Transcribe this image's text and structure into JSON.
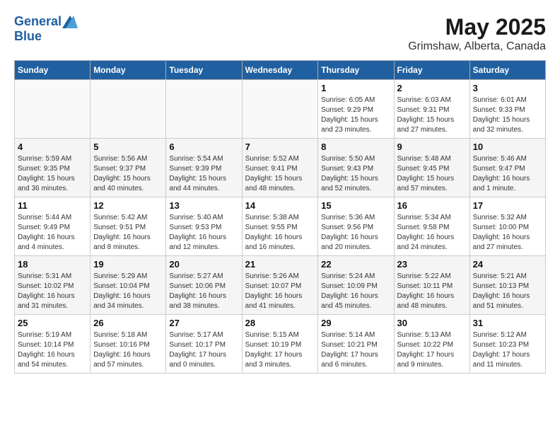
{
  "header": {
    "logo_line1": "General",
    "logo_line2": "Blue",
    "month_title": "May 2025",
    "location": "Grimshaw, Alberta, Canada"
  },
  "weekdays": [
    "Sunday",
    "Monday",
    "Tuesday",
    "Wednesday",
    "Thursday",
    "Friday",
    "Saturday"
  ],
  "weeks": [
    [
      {
        "day": "",
        "info": ""
      },
      {
        "day": "",
        "info": ""
      },
      {
        "day": "",
        "info": ""
      },
      {
        "day": "",
        "info": ""
      },
      {
        "day": "1",
        "info": "Sunrise: 6:05 AM\nSunset: 9:29 PM\nDaylight: 15 hours\nand 23 minutes."
      },
      {
        "day": "2",
        "info": "Sunrise: 6:03 AM\nSunset: 9:31 PM\nDaylight: 15 hours\nand 27 minutes."
      },
      {
        "day": "3",
        "info": "Sunrise: 6:01 AM\nSunset: 9:33 PM\nDaylight: 15 hours\nand 32 minutes."
      }
    ],
    [
      {
        "day": "4",
        "info": "Sunrise: 5:59 AM\nSunset: 9:35 PM\nDaylight: 15 hours\nand 36 minutes."
      },
      {
        "day": "5",
        "info": "Sunrise: 5:56 AM\nSunset: 9:37 PM\nDaylight: 15 hours\nand 40 minutes."
      },
      {
        "day": "6",
        "info": "Sunrise: 5:54 AM\nSunset: 9:39 PM\nDaylight: 15 hours\nand 44 minutes."
      },
      {
        "day": "7",
        "info": "Sunrise: 5:52 AM\nSunset: 9:41 PM\nDaylight: 15 hours\nand 48 minutes."
      },
      {
        "day": "8",
        "info": "Sunrise: 5:50 AM\nSunset: 9:43 PM\nDaylight: 15 hours\nand 52 minutes."
      },
      {
        "day": "9",
        "info": "Sunrise: 5:48 AM\nSunset: 9:45 PM\nDaylight: 15 hours\nand 57 minutes."
      },
      {
        "day": "10",
        "info": "Sunrise: 5:46 AM\nSunset: 9:47 PM\nDaylight: 16 hours\nand 1 minute."
      }
    ],
    [
      {
        "day": "11",
        "info": "Sunrise: 5:44 AM\nSunset: 9:49 PM\nDaylight: 16 hours\nand 4 minutes."
      },
      {
        "day": "12",
        "info": "Sunrise: 5:42 AM\nSunset: 9:51 PM\nDaylight: 16 hours\nand 8 minutes."
      },
      {
        "day": "13",
        "info": "Sunrise: 5:40 AM\nSunset: 9:53 PM\nDaylight: 16 hours\nand 12 minutes."
      },
      {
        "day": "14",
        "info": "Sunrise: 5:38 AM\nSunset: 9:55 PM\nDaylight: 16 hours\nand 16 minutes."
      },
      {
        "day": "15",
        "info": "Sunrise: 5:36 AM\nSunset: 9:56 PM\nDaylight: 16 hours\nand 20 minutes."
      },
      {
        "day": "16",
        "info": "Sunrise: 5:34 AM\nSunset: 9:58 PM\nDaylight: 16 hours\nand 24 minutes."
      },
      {
        "day": "17",
        "info": "Sunrise: 5:32 AM\nSunset: 10:00 PM\nDaylight: 16 hours\nand 27 minutes."
      }
    ],
    [
      {
        "day": "18",
        "info": "Sunrise: 5:31 AM\nSunset: 10:02 PM\nDaylight: 16 hours\nand 31 minutes."
      },
      {
        "day": "19",
        "info": "Sunrise: 5:29 AM\nSunset: 10:04 PM\nDaylight: 16 hours\nand 34 minutes."
      },
      {
        "day": "20",
        "info": "Sunrise: 5:27 AM\nSunset: 10:06 PM\nDaylight: 16 hours\nand 38 minutes."
      },
      {
        "day": "21",
        "info": "Sunrise: 5:26 AM\nSunset: 10:07 PM\nDaylight: 16 hours\nand 41 minutes."
      },
      {
        "day": "22",
        "info": "Sunrise: 5:24 AM\nSunset: 10:09 PM\nDaylight: 16 hours\nand 45 minutes."
      },
      {
        "day": "23",
        "info": "Sunrise: 5:22 AM\nSunset: 10:11 PM\nDaylight: 16 hours\nand 48 minutes."
      },
      {
        "day": "24",
        "info": "Sunrise: 5:21 AM\nSunset: 10:13 PM\nDaylight: 16 hours\nand 51 minutes."
      }
    ],
    [
      {
        "day": "25",
        "info": "Sunrise: 5:19 AM\nSunset: 10:14 PM\nDaylight: 16 hours\nand 54 minutes."
      },
      {
        "day": "26",
        "info": "Sunrise: 5:18 AM\nSunset: 10:16 PM\nDaylight: 16 hours\nand 57 minutes."
      },
      {
        "day": "27",
        "info": "Sunrise: 5:17 AM\nSunset: 10:17 PM\nDaylight: 17 hours\nand 0 minutes."
      },
      {
        "day": "28",
        "info": "Sunrise: 5:15 AM\nSunset: 10:19 PM\nDaylight: 17 hours\nand 3 minutes."
      },
      {
        "day": "29",
        "info": "Sunrise: 5:14 AM\nSunset: 10:21 PM\nDaylight: 17 hours\nand 6 minutes."
      },
      {
        "day": "30",
        "info": "Sunrise: 5:13 AM\nSunset: 10:22 PM\nDaylight: 17 hours\nand 9 minutes."
      },
      {
        "day": "31",
        "info": "Sunrise: 5:12 AM\nSunset: 10:23 PM\nDaylight: 17 hours\nand 11 minutes."
      }
    ]
  ]
}
